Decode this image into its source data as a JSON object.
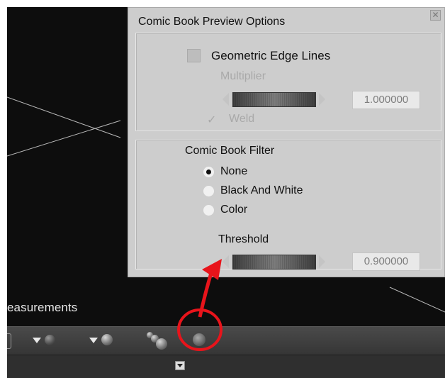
{
  "panel": {
    "title": "Comic Book Preview Options",
    "close_icon": "close-icon"
  },
  "geometric_edge": {
    "label": "Geometric Edge Lines",
    "checked": false,
    "multiplier_label": "Multiplier",
    "multiplier_value": "1.000000",
    "weld_check": "✓",
    "weld_label": "Weld"
  },
  "filter": {
    "title": "Comic Book Filter",
    "options": [
      {
        "label": "None",
        "selected": true
      },
      {
        "label": "Black And White",
        "selected": false
      },
      {
        "label": "Color",
        "selected": false
      }
    ],
    "threshold_label": "Threshold",
    "threshold_value": "0.900000"
  },
  "viewport": {
    "measurements_label": "easurements"
  },
  "annotation": {
    "color": "#e8141b"
  }
}
